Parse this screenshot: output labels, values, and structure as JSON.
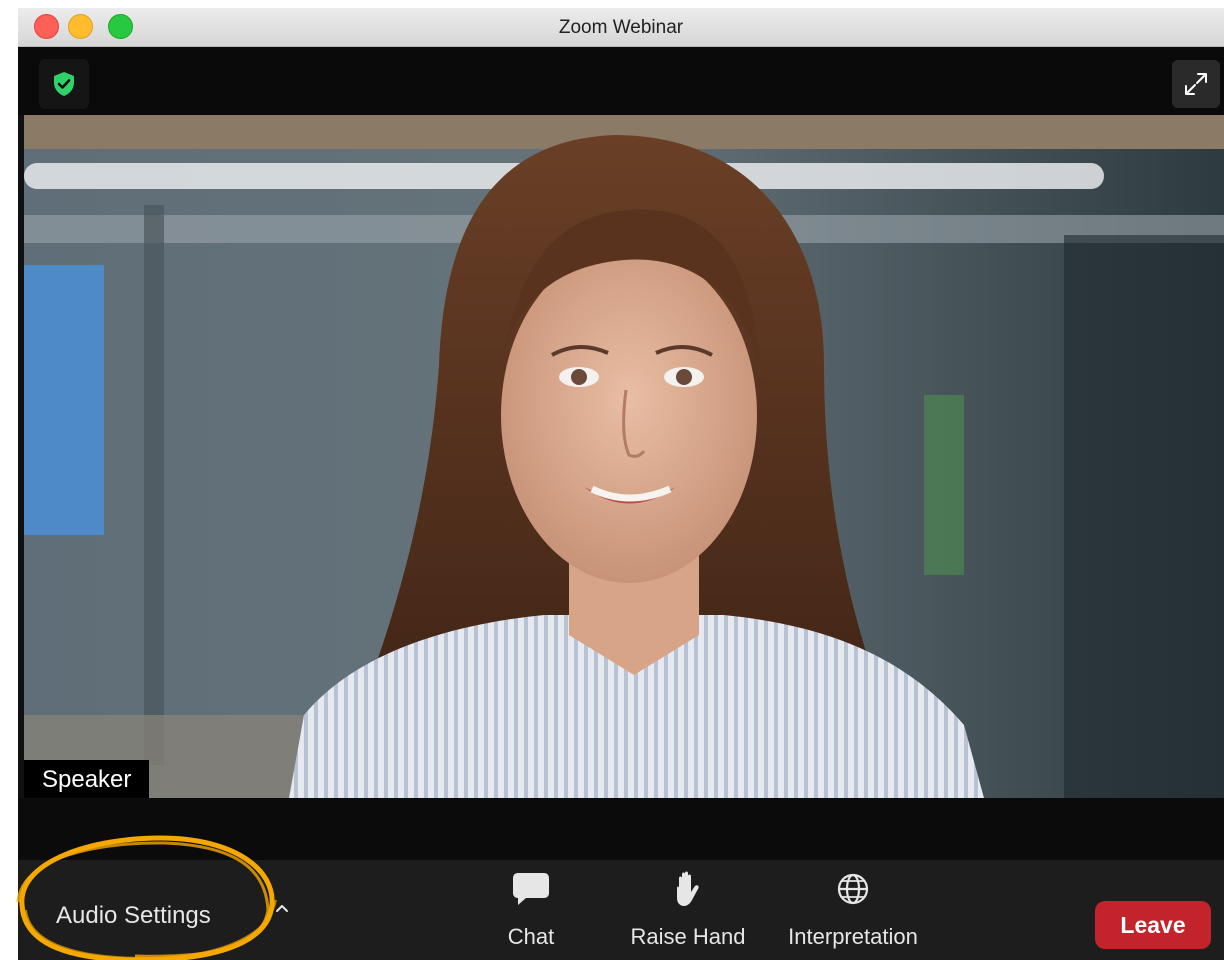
{
  "window": {
    "title": "Zoom Webinar"
  },
  "video": {
    "speaker_label": "Speaker"
  },
  "toolbar": {
    "audio_settings_label": "Audio Settings",
    "chat_label": "Chat",
    "raise_hand_label": "Raise Hand",
    "interpretation_label": "Interpretation",
    "leave_label": "Leave"
  },
  "icons": {
    "security": "shield-check-icon",
    "fullscreen": "expand-arrows-icon",
    "chat": "speech-bubble-icon",
    "raise_hand": "hand-icon",
    "interpretation": "globe-icon",
    "audio_options": "chevron-up-icon"
  },
  "colors": {
    "leave_button": "#c3232b",
    "security_shield": "#2fd16a",
    "highlight_annotation": "#f5a800"
  }
}
